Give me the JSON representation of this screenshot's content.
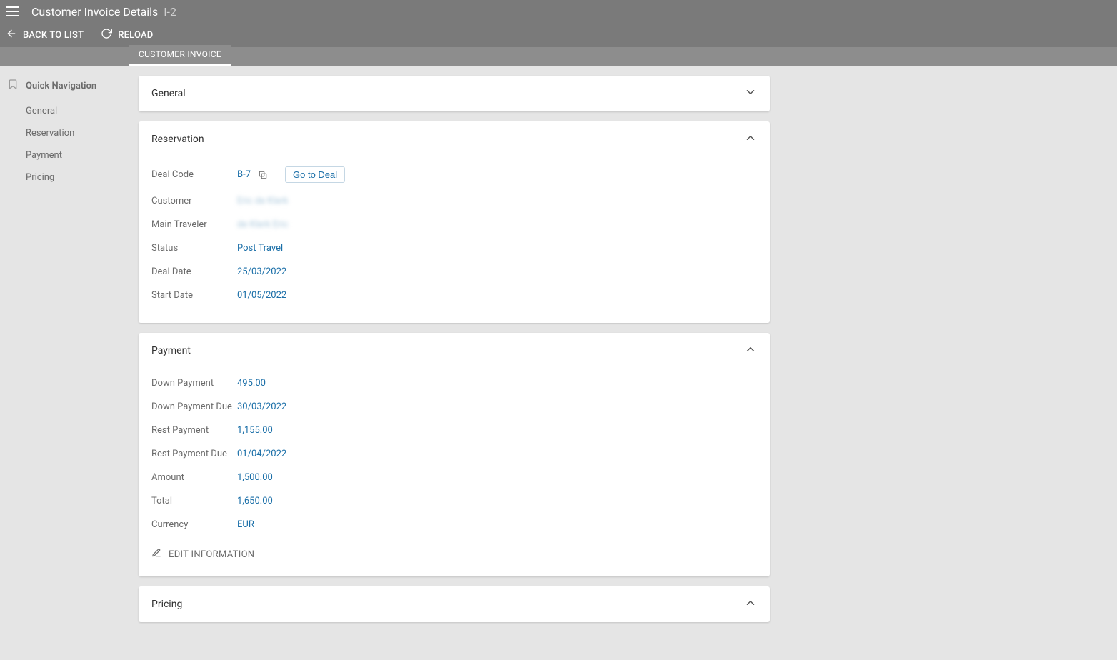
{
  "header": {
    "title": "Customer Invoice Details",
    "title_suffix": "I-2",
    "back_to_list": "BACK TO LIST",
    "reload": "RELOAD"
  },
  "tabs": {
    "customer_invoice": "CUSTOMER INVOICE"
  },
  "sidebar": {
    "quick_navigation": "Quick Navigation",
    "items": {
      "general": "General",
      "reservation": "Reservation",
      "payment": "Payment",
      "pricing": "Pricing"
    }
  },
  "cards": {
    "general": {
      "title": "General"
    },
    "reservation": {
      "title": "Reservation",
      "labels": {
        "deal_code": "Deal Code",
        "customer": "Customer",
        "main_traveler": "Main Traveler",
        "status": "Status",
        "deal_date": "Deal Date",
        "start_date": "Start Date"
      },
      "values": {
        "deal_code": "B-7",
        "customer": "Eric de Klerk",
        "main_traveler": "de Klerk Eric",
        "status": "Post Travel",
        "deal_date": "25/03/2022",
        "start_date": "01/05/2022"
      },
      "go_to_deal": "Go to Deal"
    },
    "payment": {
      "title": "Payment",
      "labels": {
        "down_payment": "Down Payment",
        "down_payment_due": "Down Payment Due",
        "rest_payment": "Rest Payment",
        "rest_payment_due": "Rest Payment Due",
        "amount": "Amount",
        "total": "Total",
        "currency": "Currency"
      },
      "values": {
        "down_payment": "495.00",
        "down_payment_due": "30/03/2022",
        "rest_payment": "1,155.00",
        "rest_payment_due": "01/04/2022",
        "amount": "1,500.00",
        "total": "1,650.00",
        "currency": "EUR"
      },
      "edit_information": "EDIT INFORMATION"
    },
    "pricing": {
      "title": "Pricing"
    }
  }
}
